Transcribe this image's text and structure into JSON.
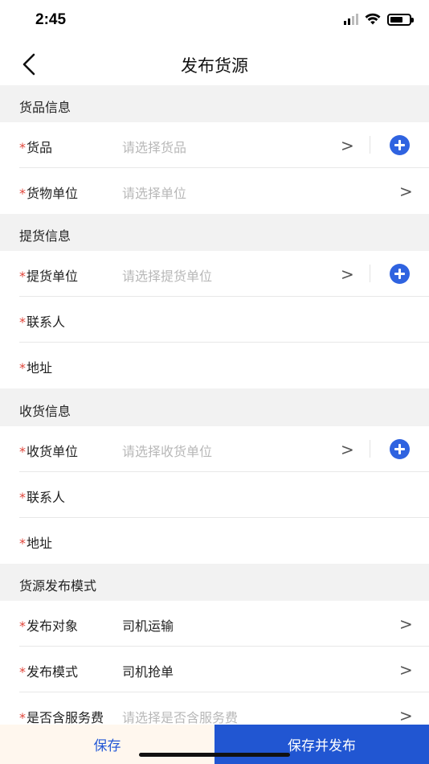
{
  "status_bar": {
    "time": "2:45"
  },
  "nav": {
    "title": "发布货源"
  },
  "sections": {
    "goods": {
      "title": "货品信息"
    },
    "pickup": {
      "title": "提货信息"
    },
    "receive": {
      "title": "收货信息"
    },
    "mode": {
      "title": "货源发布模式"
    }
  },
  "rows": {
    "goods": {
      "label": "货品",
      "placeholder": "请选择货品"
    },
    "goods_unit": {
      "label": "货物单位",
      "placeholder": "请选择单位"
    },
    "pickup_unit": {
      "label": "提货单位",
      "placeholder": "请选择提货单位"
    },
    "pickup_contact": {
      "label": "联系人"
    },
    "pickup_address": {
      "label": "地址"
    },
    "receive_unit": {
      "label": "收货单位",
      "placeholder": "请选择收货单位"
    },
    "receive_contact": {
      "label": "联系人"
    },
    "receive_address": {
      "label": "地址"
    },
    "publish_target": {
      "label": "发布对象",
      "value": "司机运输"
    },
    "publish_mode": {
      "label": "发布模式",
      "value": "司机抢单"
    },
    "service_fee": {
      "label": "是否含服务费",
      "placeholder": "请选择是否含服务费"
    }
  },
  "required_mark": "*",
  "chevron": ">",
  "buttons": {
    "save": "保存",
    "save_publish": "保存并发布"
  },
  "colors": {
    "accent": "#2156d2",
    "required": "#e0453a",
    "add_button": "#2f63e0"
  },
  "icons": {
    "back": "chevron-left-icon",
    "add": "plus-circle-icon",
    "signal": "signal-icon",
    "wifi": "wifi-icon",
    "battery": "battery-icon"
  }
}
